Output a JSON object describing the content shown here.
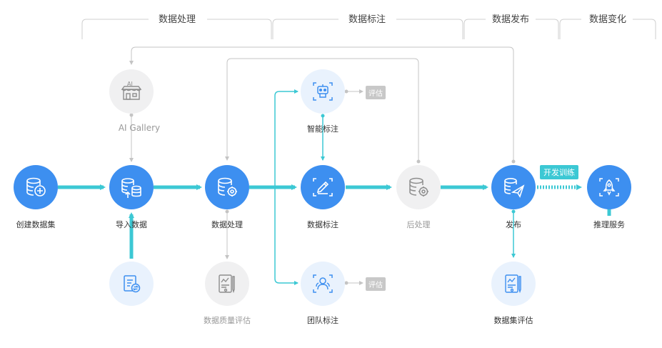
{
  "stages": [
    {
      "label": "数据处理"
    },
    {
      "label": "数据标注"
    },
    {
      "label": "数据发布"
    },
    {
      "label": "数据变化"
    }
  ],
  "nodes": {
    "create_dataset": "创建数据集",
    "import_data": "导入数据",
    "ai_gallery": "AI Gallery",
    "data_processing": "数据处理",
    "data_quality": "数据质量评估",
    "smart_labeling": "智能标注",
    "data_labeling": "数据标注",
    "team_labeling": "团队标注",
    "post_processing": "后处理",
    "publish": "发布",
    "dataset_eval": "数据集评估",
    "inference": "推理服务"
  },
  "tags": {
    "eval_smart": "评估",
    "eval_team": "评估",
    "dev_training": "开发训练"
  },
  "colors": {
    "primary": "#3d8ff0",
    "flow": "#3cc8d4",
    "muted": "#c8c8c8"
  }
}
